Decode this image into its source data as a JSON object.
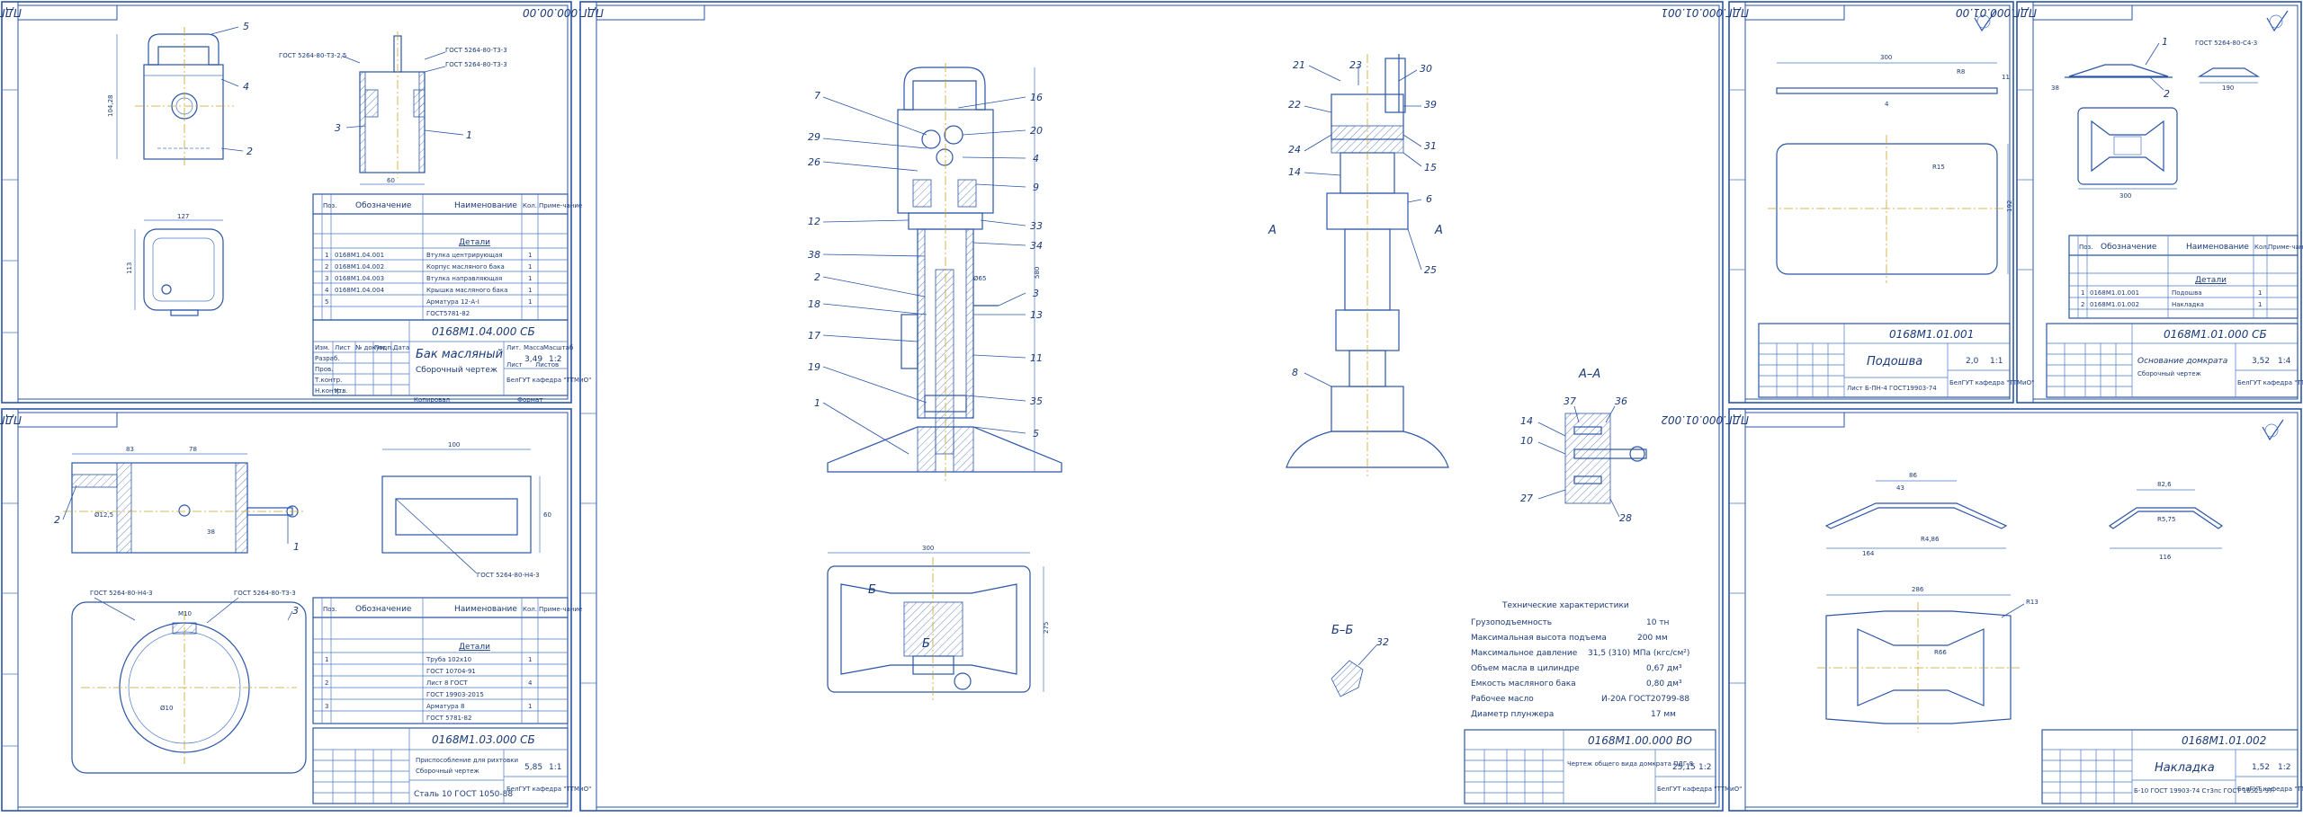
{
  "sheets": {
    "tank": {
      "corner_code": "ПДГ.000.00.00.01",
      "title": "Бак масляный",
      "subtitle": "Сборочный чертеж",
      "code": "0168М1.04.000 СБ",
      "mass": "3,49",
      "scale": "1:2",
      "dept": "БелГУТ кафедра \"ТТМиО\"",
      "bom_header": [
        "Поз.",
        "Обозначение",
        "Наименование",
        "Кол.",
        "Приме-чание"
      ],
      "bom_section": "Детали",
      "bom_rows": [
        {
          "pos": "1",
          "code": "0168М1.04.001",
          "name": "Втулка центрирующая",
          "qty": "1"
        },
        {
          "pos": "2",
          "code": "0168М1.04.002",
          "name": "Корпус масляного бака",
          "qty": "1"
        },
        {
          "pos": "3",
          "code": "0168М1.04.003",
          "name": "Втулка направляющая",
          "qty": "1"
        },
        {
          "pos": "4",
          "code": "0168М1.04.004",
          "name": "Крышка масляного бака",
          "qty": "1"
        },
        {
          "pos": "5",
          "code": "",
          "name": "Арматура 12-А-I",
          "qty": "1"
        },
        {
          "pos": "",
          "code": "",
          "name": "ГОСТ5781-82",
          "qty": ""
        }
      ],
      "notes": [
        "ГОСТ 5264-80-Т3-2,5",
        "ГОСТ 5264-80-Т3-3",
        "ГОСТ 5264-80-Т3-3"
      ],
      "dims": [
        "104,28",
        "60",
        "127",
        "113"
      ],
      "positions": [
        "1",
        "2",
        "3",
        "4",
        "5"
      ]
    },
    "fixture": {
      "corner_code": "ПДГ.000.00.00.01",
      "title": "Приспособление для рихтовки",
      "subtitle": "Сборочный чертеж",
      "material": "Сталь 10 ГОСТ 1050-88",
      "code": "0168М1.03.000 СБ",
      "mass": "5,85",
      "scale": "1:1",
      "dept": "БелГУТ кафедра \"ТТМиО\"",
      "bom_header": [
        "Поз.",
        "Обозначение",
        "Наименование",
        "Кол.",
        "Приме-чание"
      ],
      "bom_section": "Детали",
      "bom_rows": [
        {
          "pos": "1",
          "code": "",
          "name": "Труба 102х10",
          "qty": "1"
        },
        {
          "pos": "",
          "code": "",
          "name": "ГОСТ 10704-91",
          "qty": ""
        },
        {
          "pos": "2",
          "code": "",
          "name": "Лист 8 ГОСТ",
          "qty": "4"
        },
        {
          "pos": "",
          "code": "",
          "name": "ГОСТ 19903-2015",
          "qty": ""
        },
        {
          "pos": "3",
          "code": "",
          "name": "Арматура 8",
          "qty": "1"
        },
        {
          "pos": "",
          "code": "",
          "name": "ГОСТ 5781-82",
          "qty": ""
        }
      ],
      "notes": [
        "ГОСТ 5264-80-Н4-3",
        "ГОСТ 5264-80-Т3-3",
        "ГОСТ 5264-80-Н4-3"
      ],
      "dims": [
        "83",
        "78",
        "100",
        "38",
        "60",
        "Ø12,5",
        "М10",
        "Ø10"
      ],
      "positions": [
        "1",
        "2",
        "3"
      ]
    },
    "assembly": {
      "corner_code": "ПДГ.000.00.00",
      "title": "Чертеж общего вида домкрата ПДГ-8",
      "code": "0168М1.00.000 ВО",
      "mass": "25,15",
      "scale": "1:2",
      "dept": "БелГУТ кафедра \"ТТМиО\"",
      "section_labels": [
        "А–А",
        "Б–Б",
        "А",
        "А",
        "Б",
        "Б"
      ],
      "dims": [
        "300",
        "580",
        "275",
        "Ø65"
      ],
      "positions_left": [
        "7",
        "29",
        "26",
        "12",
        "38",
        "2",
        "18",
        "17",
        "19",
        "1",
        "16",
        "20",
        "4",
        "9",
        "33",
        "34",
        "3",
        "13",
        "11",
        "35",
        "5"
      ],
      "positions_right": [
        "21",
        "23",
        "30",
        "22",
        "39",
        "24",
        "31",
        "15",
        "14",
        "6",
        "25",
        "8"
      ],
      "positions_section": [
        "37",
        "36",
        "14",
        "10",
        "27",
        "28",
        "32"
      ],
      "specs_title": "Технические характеристики",
      "specs": [
        {
          "label": "Грузоподъемность",
          "value": "10 тн"
        },
        {
          "label": "Максимальная высота подъема",
          "value": "200 мм"
        },
        {
          "label": "Максимальное давление",
          "value": "31,5 (310) МПа (кгс/см²)"
        },
        {
          "label": "Объем масла в цилиндре",
          "value": "0,67 дм³"
        },
        {
          "label": "Емкость масляного бака",
          "value": "0,80 дм³"
        },
        {
          "label": "Рабочее масло",
          "value": "И-20А ГОСТ20799-88"
        },
        {
          "label": "Диаметр плунжера",
          "value": "17 мм"
        }
      ]
    },
    "sole": {
      "corner_code": "ПДГ.000.01.001",
      "title": "Подошва",
      "material": "Лист Б-ПН-4 ГОСТ19903-74",
      "code": "0168М1.01.001",
      "mass": "2,0",
      "scale": "1:1",
      "dept": "БелГУТ кафедра \"ТТМиО\"",
      "dims": [
        "300",
        "R15",
        "R8",
        "192",
        "11",
        "4"
      ]
    },
    "base": {
      "corner_code": "ПДГ.000.01.00",
      "title": "Основание домкрата",
      "subtitle": "Сборочный чертеж",
      "code": "0168М1.01.000 СБ",
      "mass": "3,52",
      "scale": "1:4",
      "dept": "БелГУТ кафедра \"ТТМиО\"",
      "bom_header": [
        "Поз.",
        "Обозначение",
        "Наименование",
        "Кол.",
        "Приме-чание"
      ],
      "bom_section": "Детали",
      "bom_rows": [
        {
          "pos": "1",
          "code": "0168М1.01.001",
          "name": "Подошва",
          "qty": "1"
        },
        {
          "pos": "2",
          "code": "0168М1.01.002",
          "name": "Накладка",
          "qty": "1"
        }
      ],
      "notes": [
        "ГОСТ 5264-80-С4-3"
      ],
      "dims": [
        "300",
        "190",
        "38"
      ],
      "positions": [
        "1",
        "2"
      ]
    },
    "plate": {
      "corner_code": "ПДГ.000.01.002",
      "title": "Накладка",
      "material": "Б-10 ГОСТ 19903-74 Ст3пс ГОСТ 16523-97",
      "code": "0168М1.01.002",
      "mass": "1,52",
      "scale": "1:2",
      "dept": "БелГУТ кафедра \"ТТМиО\"",
      "dims": [
        "86",
        "43",
        "164",
        "R4,86",
        "82,6",
        "R5,75",
        "116",
        "286",
        "R13",
        "R66"
      ]
    }
  },
  "title_block_labels": [
    "Изм.",
    "Лист",
    "№ докум.",
    "Подп.",
    "Дата",
    "Разраб.",
    "Пров.",
    "Т.контр.",
    "Н.контр.",
    "Утв.",
    "Лит.",
    "Масса",
    "Масштаб",
    "Лист",
    "Листов",
    "Копировал",
    "Формат"
  ],
  "colors": {
    "line": "#2a55a8",
    "center_line": "#c9a227",
    "background": "#ffffff"
  }
}
